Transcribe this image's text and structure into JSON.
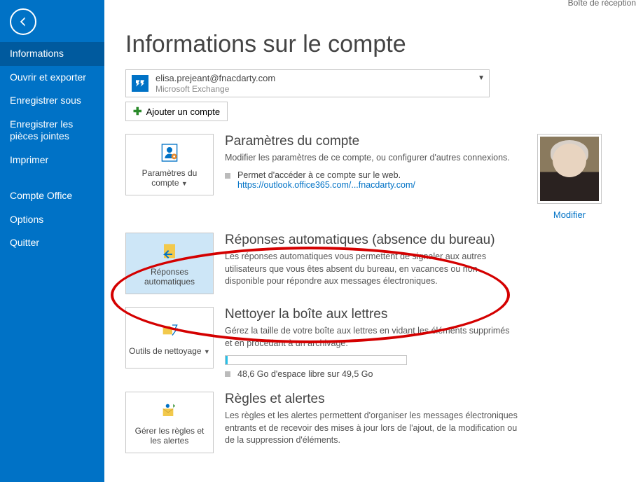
{
  "inbox_label": "Boîte de réception",
  "sidebar": {
    "items": [
      {
        "label": "Informations",
        "active": true
      },
      {
        "label": "Ouvrir et exporter"
      },
      {
        "label": "Enregistrer sous"
      },
      {
        "label": "Enregistrer les pièces jointes"
      },
      {
        "label": "Imprimer"
      }
    ],
    "items2": [
      {
        "label": "Compte Office"
      },
      {
        "label": "Options"
      },
      {
        "label": "Quitter"
      }
    ]
  },
  "title": "Informations sur le compte",
  "account": {
    "email": "elisa.prejeant@fnacdarty.com",
    "type": "Microsoft Exchange"
  },
  "add_account": "Ajouter un compte",
  "sec_params": {
    "tile": "Paramètres du compte",
    "heading": "Paramètres du compte",
    "desc": "Modifier les paramètres de ce compte, ou configurer d'autres connexions.",
    "bullet": "Permet d'accéder à ce compte sur le web.",
    "link": "https://outlook.office365.com/...fnacdarty.com/"
  },
  "avatar_link": "Modifier",
  "sec_auto": {
    "tile": "Réponses automatiques",
    "heading": "Réponses automatiques (absence du bureau)",
    "desc": "Les réponses automatiques vous permettent de signaler aux autres utilisateurs que vous êtes absent du bureau, en vacances ou non disponible pour répondre aux messages électroniques."
  },
  "sec_clean": {
    "tile": "Outils de nettoyage",
    "heading": "Nettoyer la boîte aux lettres",
    "desc": "Gérez la taille de votre boîte aux lettres en vidant les éléments supprimés et en procédant à un archivage.",
    "storage": "48,6 Go d'espace libre sur 49,5 Go"
  },
  "sec_rules": {
    "tile": "Gérer les règles et les alertes",
    "heading": "Règles et alertes",
    "desc": "Les règles et les alertes permettent d'organiser les messages électroniques entrants et de recevoir des mises à jour lors de l'ajout, de la modification ou de la suppression d'éléments."
  }
}
